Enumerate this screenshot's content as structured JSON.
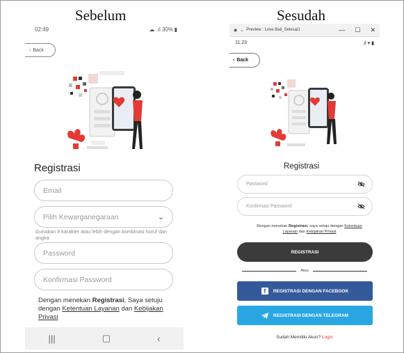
{
  "captions": {
    "left": "Sebelum",
    "right": "Sesudah"
  },
  "before": {
    "status": {
      "time": "02:49",
      "right": "☁ .ıl 30% ▮"
    },
    "back_label": "Back",
    "title": "Registrasi",
    "fields": {
      "email_placeholder": "Email",
      "nationality_placeholder": "Pilih Kewarganegaraan",
      "password_placeholder": "Password",
      "confirm_placeholder": "Konfirmasi Password"
    },
    "password_hint": "Gunakan 8 karakter atau lebih dengan kombinasi huruf dan angka",
    "terms": {
      "prefix": "Dengan menekan ",
      "bold": "Registrasi",
      "mid": ", Saya setuju dengan ",
      "link1": "Ketentuan Layanan",
      "and": " dan ",
      "link2": "Kebijakan Privasi"
    },
    "navbar": {
      "recents": "|||",
      "home": "▢",
      "back": "‹"
    }
  },
  "after": {
    "window": {
      "title": "Preview : Love Bali_Selesai1",
      "min": "—",
      "max": "☐",
      "close": "✕"
    },
    "status": {
      "time": "11.23",
      "right": ".ıl ▾ ▮"
    },
    "back_label": "Back",
    "title": "Registrasi",
    "fields": {
      "password_placeholder": "Password",
      "confirm_placeholder": "Konfirmasi Password"
    },
    "terms": {
      "prefix": "Dengan menekan ",
      "bold": "Registrasi",
      "mid": ", saya setuju dengan ",
      "link1": "Ketentuan Layanan",
      "and": " dan ",
      "link2": "Kebijakan Privasi"
    },
    "register_button": "REGISTRASI",
    "divider_label": "Atau",
    "facebook_button": "REGISTRASI DENGAN FACEBOOK",
    "telegram_button": "REGISTRASI DENGAN TELEGRAM",
    "login_prompt": "Sudah Memiliki Akun? ",
    "login_link": "Login"
  },
  "colors": {
    "accent_red": "#e23b35",
    "dark_button": "#3b3b3b",
    "facebook_blue": "#355a9b",
    "telegram_blue": "#2aa7e3"
  }
}
